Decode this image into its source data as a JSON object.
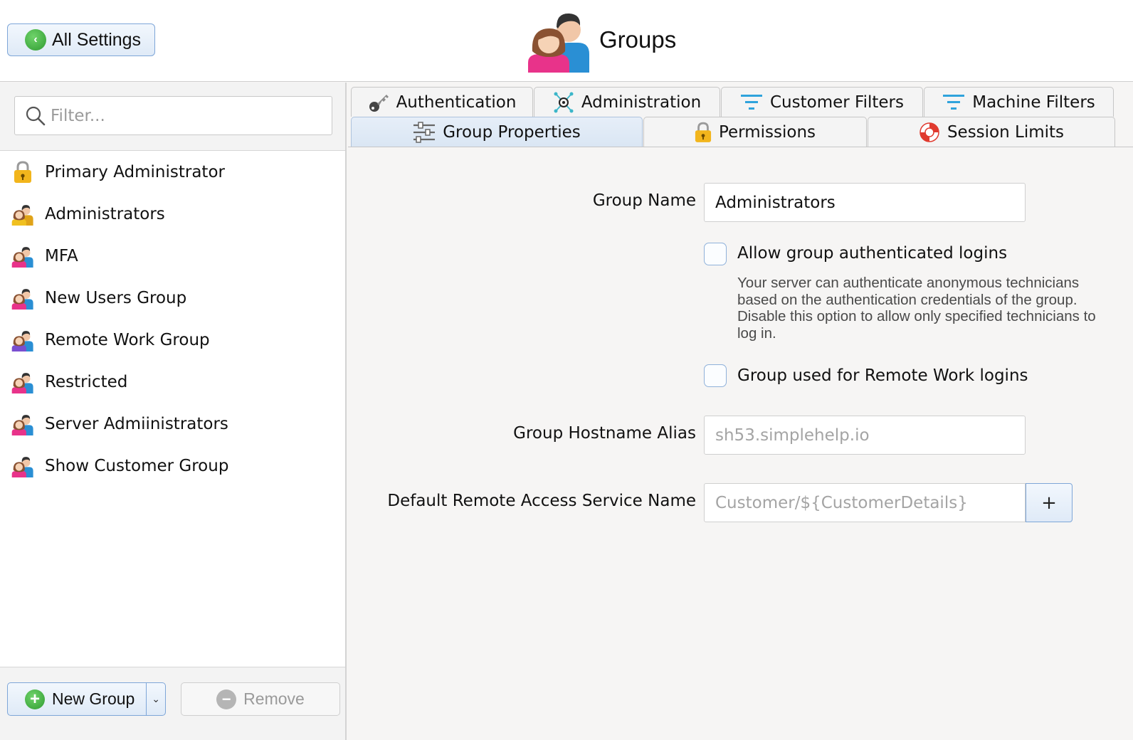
{
  "header": {
    "back_button_label": "All Settings",
    "title": "Groups",
    "title_icon": "groups-people-icon"
  },
  "sidebar": {
    "filter_placeholder": "Filter...",
    "items": [
      {
        "label": "Primary Administrator",
        "icon": "lock-icon"
      },
      {
        "label": "Administrators",
        "icon": "group-icon-gold"
      },
      {
        "label": "MFA",
        "icon": "group-icon"
      },
      {
        "label": "New Users Group",
        "icon": "group-icon"
      },
      {
        "label": "Remote Work Group",
        "icon": "group-icon-purple"
      },
      {
        "label": "Restricted",
        "icon": "group-icon"
      },
      {
        "label": "Server Admiinistrators",
        "icon": "group-icon"
      },
      {
        "label": "Show Customer Group",
        "icon": "group-icon"
      }
    ],
    "new_group_label": "New Group",
    "remove_label": "Remove"
  },
  "tabs": {
    "row1": [
      {
        "label": "Authentication",
        "icon": "key-icon"
      },
      {
        "label": "Administration",
        "icon": "network-gear-icon"
      },
      {
        "label": "Customer Filters",
        "icon": "filter-icon"
      },
      {
        "label": "Machine Filters",
        "icon": "filter-icon"
      }
    ],
    "row2": [
      {
        "label": "Group Properties",
        "icon": "sliders-icon",
        "active": true
      },
      {
        "label": "Permissions",
        "icon": "lock-icon"
      },
      {
        "label": "Session Limits",
        "icon": "lifebuoy-icon"
      }
    ]
  },
  "form": {
    "group_name_label": "Group Name",
    "group_name_value": "Administrators",
    "allow_group_auth_label": "Allow group authenticated logins",
    "allow_group_auth_checked": false,
    "allow_group_auth_help": "Your server can authenticate anonymous technicians based on the authentication credentials of the group. Disable this option to allow only specified technicians to log in.",
    "remote_work_label": "Group used for Remote Work logins",
    "remote_work_checked": false,
    "hostname_alias_label": "Group Hostname Alias",
    "hostname_alias_placeholder": "sh53.simplehelp.io",
    "default_service_label": "Default Remote Access Service Name",
    "default_service_placeholder": "Customer/${CustomerDetails}",
    "add_variable_label": "+"
  },
  "colors": {
    "accent_blue": "#7ea6d8",
    "green": "#2f9b31",
    "female_pink": "#e8338a",
    "male_blue": "#2a8fd4"
  }
}
